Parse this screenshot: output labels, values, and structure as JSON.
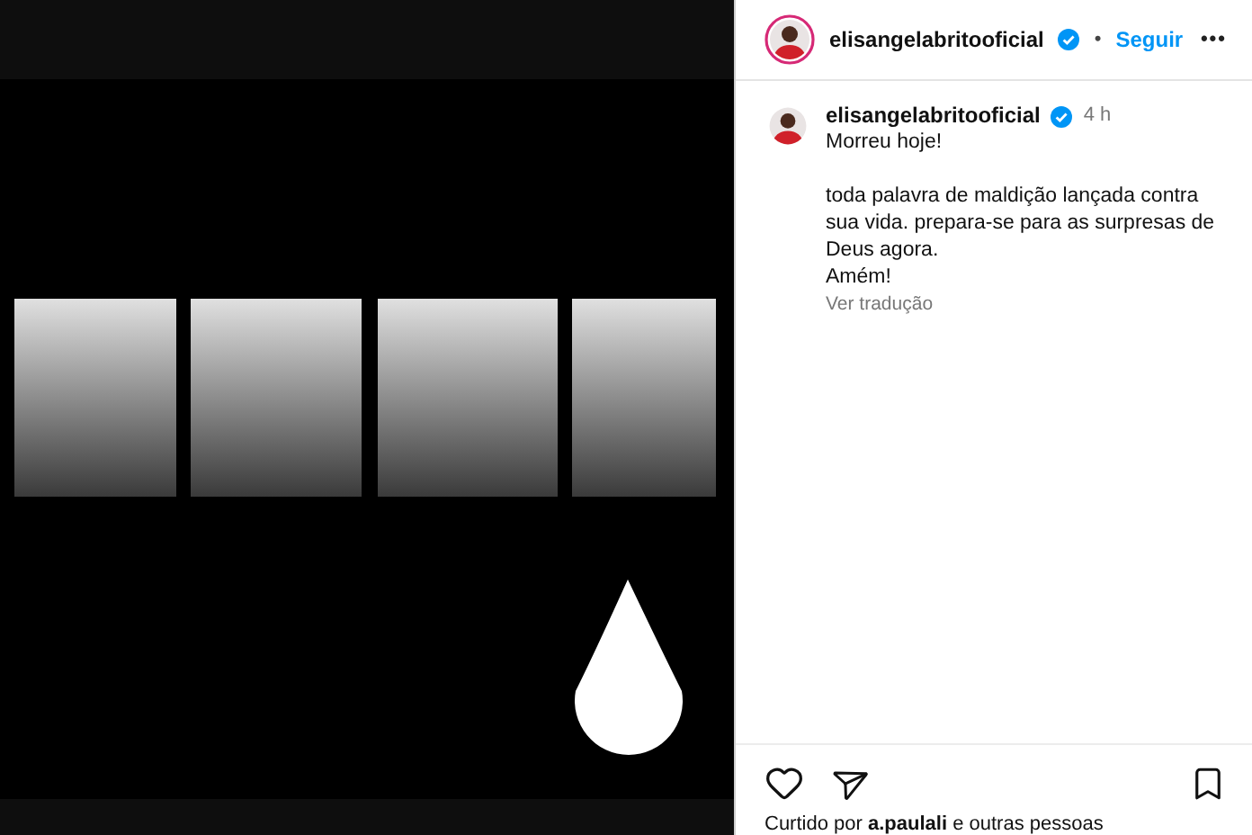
{
  "header": {
    "username": "elisangelabritooficial",
    "verified": true,
    "separator": "•",
    "follow": "Seguir",
    "more": "•••"
  },
  "caption": {
    "username": "elisangelabritooficial",
    "verified": true,
    "time": "4 h",
    "paragraphs": [
      "Morreu hoje!",
      "toda palavra de maldição lançada contra sua vida. prepara-se para as surpresas de Deus agora.\nAmém!"
    ],
    "translate": "Ver tradução"
  },
  "actions": {
    "liked": false,
    "saved": false
  },
  "likes": "Curtido por **a.paulali** e outras pessoas"
}
